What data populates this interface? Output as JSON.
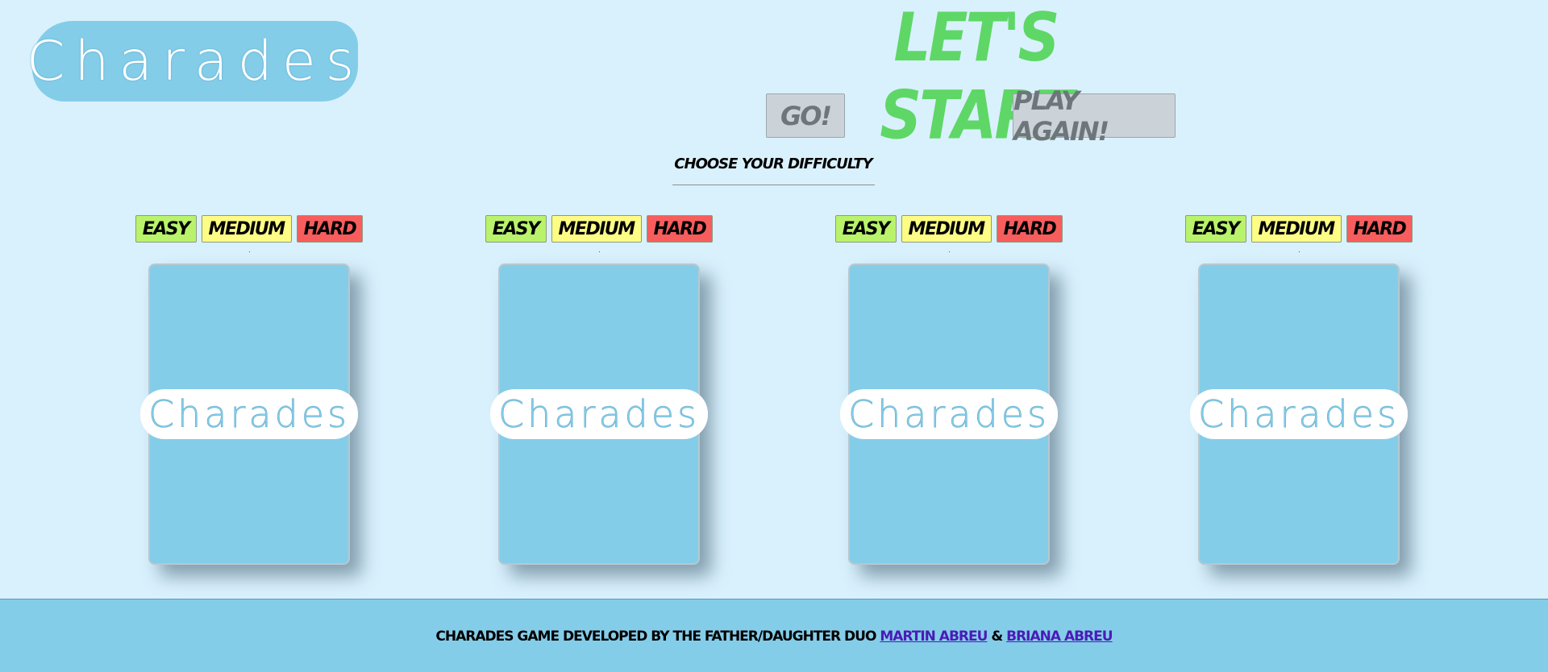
{
  "header": {
    "logo_text": "Charades",
    "title": "LET'S START",
    "go_button": "GO!",
    "play_again_button": "PLAY AGAIN!",
    "difficulty_prompt": "CHOOSE YOUR DIFFICULTY"
  },
  "cards": [
    {
      "levels": [
        "EASY",
        "MEDIUM",
        "HARD"
      ],
      "card_logo": "Charades"
    },
    {
      "levels": [
        "EASY",
        "MEDIUM",
        "HARD"
      ],
      "card_logo": "Charades"
    },
    {
      "levels": [
        "EASY",
        "MEDIUM",
        "HARD"
      ],
      "card_logo": "Charades"
    },
    {
      "levels": [
        "EASY",
        "MEDIUM",
        "HARD"
      ],
      "card_logo": "Charades"
    }
  ],
  "footer": {
    "text": "CHARADES GAME DEVELOPED BY THE FATHER/DAUGHTER DUO",
    "author1": "MARTIN ABREU",
    "separator": "&",
    "author2": "BRIANA ABREU"
  },
  "colors": {
    "background": "#d9f1fd",
    "brand_blue": "#84cde9",
    "title_green": "#5ed766",
    "easy": "#b8f36b",
    "medium": "#fdfc85",
    "hard": "#f75d5c",
    "link": "#4b1bb8"
  }
}
